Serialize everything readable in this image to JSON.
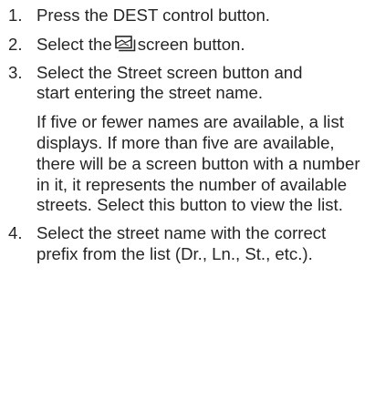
{
  "steps": [
    {
      "number": "1.",
      "text": "Press the DEST control button."
    },
    {
      "number": "2.",
      "before": "Select the",
      "icon": "screen-icon",
      "after": "screen button."
    },
    {
      "number": "3.",
      "text": "Select the Street screen button and start entering the street name.",
      "note": "If five or fewer names are available, a list displays. If more than five are available, there will be a screen button with a number in it, it represents the number of available streets. Select this button to view the list."
    },
    {
      "number": "4.",
      "text": "Select the street name with the correct prefix from the list (Dr., Ln., St., etc.)."
    }
  ],
  "colors": {
    "text": "#262626",
    "background": "#ffffff"
  }
}
